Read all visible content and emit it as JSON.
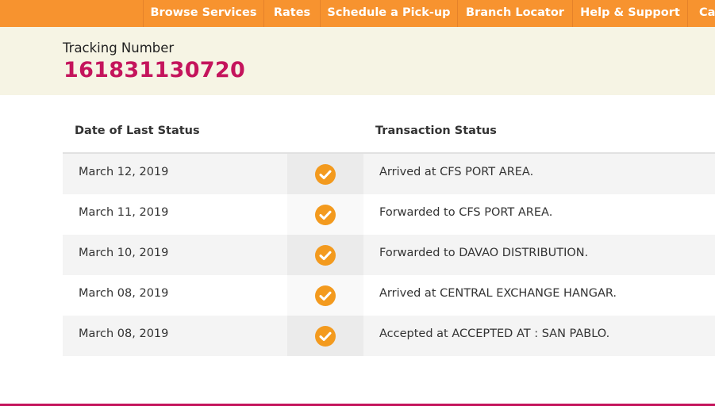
{
  "nav": {
    "items": [
      {
        "label": "Browse Services"
      },
      {
        "label": "Rates"
      },
      {
        "label": "Schedule a Pick-up"
      },
      {
        "label": "Branch Locator"
      },
      {
        "label": "Help & Support"
      },
      {
        "label": "Ca"
      }
    ]
  },
  "tracking": {
    "label": "Tracking Number",
    "number": "161831130720"
  },
  "table": {
    "headers": {
      "date": "Date of Last Status",
      "status": "Transaction Status"
    },
    "rows": [
      {
        "date": "March 12, 2019",
        "status": "Arrived at CFS PORT AREA.",
        "icon": "check-circle-icon"
      },
      {
        "date": "March 11, 2019",
        "status": "Forwarded to CFS PORT AREA.",
        "icon": "check-circle-icon"
      },
      {
        "date": "March 10, 2019",
        "status": "Forwarded to DAVAO DISTRIBUTION.",
        "icon": "check-circle-icon"
      },
      {
        "date": "March 08, 2019",
        "status": "Arrived at CENTRAL EXCHANGE HANGAR.",
        "icon": "check-circle-icon"
      },
      {
        "date": "March 08, 2019",
        "status": "Accepted at ACCEPTED AT : SAN PABLO.",
        "icon": "check-circle-icon"
      }
    ]
  },
  "colors": {
    "nav_bg": "#f7932f",
    "banner_bg": "#f6f4e4",
    "tracking_number": "#c4145c",
    "check": "#f39a1e"
  }
}
